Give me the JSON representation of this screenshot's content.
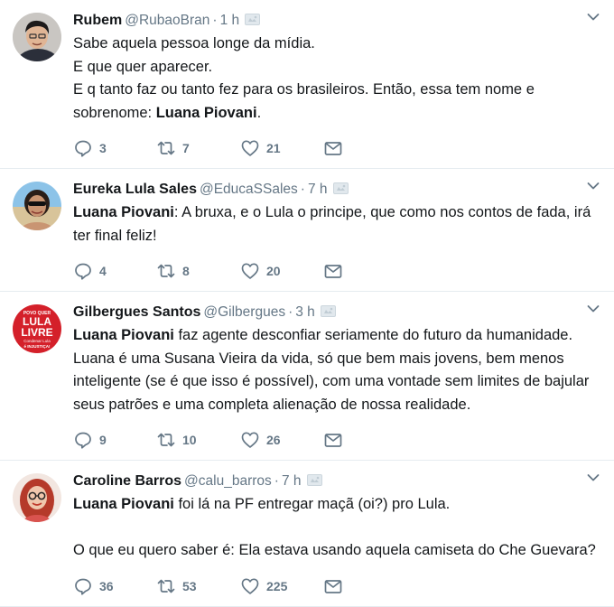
{
  "tweets": [
    {
      "name": "Rubem",
      "handle": "@RubaoBran",
      "time": "1 h",
      "lines": [
        [
          {
            "t": "Sabe aquela pessoa longe da mídia."
          }
        ],
        [
          {
            "t": "E que quer aparecer."
          }
        ],
        [
          {
            "t": "E q tanto faz ou tanto fez para os brasileiros. Então, essa tem nome e"
          }
        ],
        [
          {
            "t": "sobrenome: "
          },
          {
            "t": "Luana Piovani",
            "b": true
          },
          {
            "t": "."
          }
        ]
      ],
      "replies": "3",
      "retweets": "7",
      "likes": "21",
      "avatar": "dark-hair-man"
    },
    {
      "name": "Eureka Lula Sales",
      "handle": "@EducaSSales",
      "time": "7 h",
      "lines": [
        [
          {
            "t": "Luana Piovani",
            "b": true
          },
          {
            "t": ": A bruxa, e o Lula o principe, que como nos contos de fada, irá"
          }
        ],
        [
          {
            "t": "ter final feliz!"
          }
        ]
      ],
      "replies": "4",
      "retweets": "8",
      "likes": "20",
      "avatar": "woman-sunglasses-beach"
    },
    {
      "name": "Gilbergues Santos",
      "handle": "@Gilbergues",
      "time": "3 h",
      "lines": [
        [
          {
            "t": "Luana Piovani",
            "b": true
          },
          {
            "t": " faz agente desconfiar seriamente do futuro da humanidade."
          }
        ],
        [
          {
            "t": "Luana é uma Susana Vieira da vida, só que bem mais jovens, bem menos"
          }
        ],
        [
          {
            "t": "inteligente (se é que isso é possível), com uma vontade sem limites de bajular"
          }
        ],
        [
          {
            "t": "seus patrões e uma completa alienação de nossa realidade."
          }
        ]
      ],
      "replies": "9",
      "retweets": "10",
      "likes": "26",
      "avatar": "lula-livre-badge",
      "avatar_text": {
        "top": "POVO QUER",
        "l1": "LULA",
        "l2": "LIVRE",
        "b1": "Condenar Lula",
        "b2": "é INJUSTIÇA!"
      }
    },
    {
      "name": "Caroline Barros",
      "handle": "@calu_barros",
      "time": "7 h",
      "lines": [
        [
          {
            "t": "Luana Piovani",
            "b": true
          },
          {
            "t": " foi lá na PF entregar maçã (oi?) pro Lula."
          }
        ],
        [],
        [
          {
            "t": "O que eu quero saber é: Ela estava usando aquela camiseta do Che Guevara?"
          }
        ]
      ],
      "replies": "36",
      "retweets": "53",
      "likes": "225",
      "avatar": "woman-glasses-red-hair"
    }
  ],
  "icons": {
    "reply": "reply-icon",
    "retweet": "retweet-icon",
    "like": "heart-icon",
    "dm": "envelope-icon",
    "caret": "chevron-down-icon",
    "badge": "translucent-badge-icon"
  },
  "colors": {
    "text": "#14171a",
    "secondary": "#657786",
    "divider": "#e6ecf0",
    "lula_red": "#d4202a"
  }
}
